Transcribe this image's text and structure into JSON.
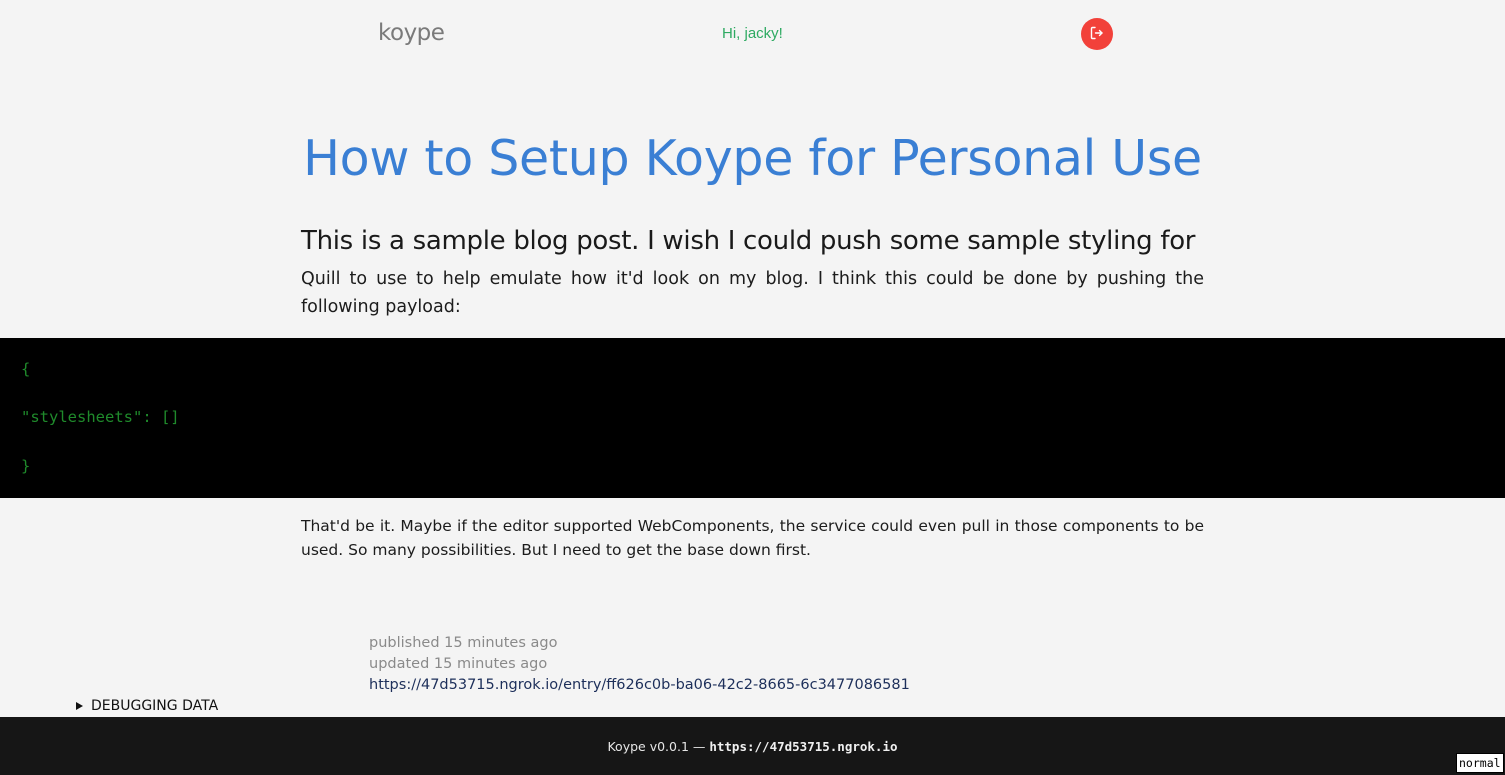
{
  "header": {
    "logo": "koype",
    "greeting": "Hi, jacky!",
    "logout_icon": "logout-icon",
    "logout_color": "#f2413a"
  },
  "post": {
    "title": "How to Setup Koype for Personal Use",
    "lead": "This is a sample blog post. I wish I could push some sample styling for",
    "para1": "Quill to use to help emulate how it'd look on my blog. I think this could be done by pushing the following payload:",
    "code": [
      "{",
      "\"stylesheets\": []",
      "}"
    ],
    "para2": "That'd be it. Maybe if the editor supported WebComponents, the service could even pull in those components to be used. So many possibilities. But I need to get the base down first."
  },
  "meta": {
    "published": "published 15 minutes ago",
    "updated": "updated 15 minutes ago",
    "url": "https://47d53715.ngrok.io/entry/ff626c0b-ba06-42c2-8665-6c3477086581"
  },
  "debug": {
    "label": "DEBUGGING DATA"
  },
  "footer": {
    "version": "Koype v0.0.1",
    "separator": " — ",
    "url": "https://47d53715.ngrok.io"
  },
  "mode_badge": "normal",
  "colors": {
    "title": "#3a7fd4",
    "greeting": "#2eaa62",
    "code_text": "#1f8a2b",
    "footer_bg": "#161616"
  }
}
